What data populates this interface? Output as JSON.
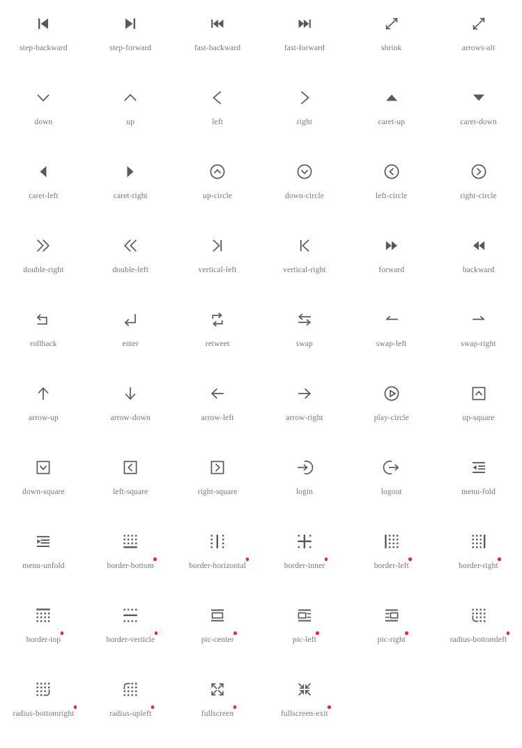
{
  "page": {
    "title": "Direction Icons",
    "icon_color": "#595959",
    "label_color": "#767676",
    "new_badge_color": "#f5222d",
    "background": "#ffffff",
    "columns": 6
  },
  "icons": [
    {
      "name": "step-backward",
      "glyph": "step-backward",
      "is_new": false
    },
    {
      "name": "step-forward",
      "glyph": "step-forward",
      "is_new": false
    },
    {
      "name": "fast-backward",
      "glyph": "fast-backward",
      "is_new": false
    },
    {
      "name": "fast-forward",
      "glyph": "fast-forward",
      "is_new": false
    },
    {
      "name": "shrink",
      "glyph": "shrink",
      "is_new": false
    },
    {
      "name": "arrows-alt",
      "glyph": "arrows-alt",
      "is_new": false
    },
    {
      "name": "down",
      "glyph": "down",
      "is_new": false
    },
    {
      "name": "up",
      "glyph": "up",
      "is_new": false
    },
    {
      "name": "left",
      "glyph": "left",
      "is_new": false
    },
    {
      "name": "right",
      "glyph": "right",
      "is_new": false
    },
    {
      "name": "caret-up",
      "glyph": "caret-up",
      "is_new": false
    },
    {
      "name": "caret-down",
      "glyph": "caret-down",
      "is_new": false
    },
    {
      "name": "caret-left",
      "glyph": "caret-left",
      "is_new": false
    },
    {
      "name": "caret-right",
      "glyph": "caret-right",
      "is_new": false
    },
    {
      "name": "up-circle",
      "glyph": "up-circle",
      "is_new": false
    },
    {
      "name": "down-circle",
      "glyph": "down-circle",
      "is_new": false
    },
    {
      "name": "left-circle",
      "glyph": "left-circle",
      "is_new": false
    },
    {
      "name": "right-circle",
      "glyph": "right-circle",
      "is_new": false
    },
    {
      "name": "double-right",
      "glyph": "double-right",
      "is_new": false
    },
    {
      "name": "double-left",
      "glyph": "double-left",
      "is_new": false
    },
    {
      "name": "vertical-left",
      "glyph": "vertical-left",
      "is_new": false
    },
    {
      "name": "vertical-right",
      "glyph": "vertical-right",
      "is_new": false
    },
    {
      "name": "forward",
      "glyph": "forward",
      "is_new": false
    },
    {
      "name": "backward",
      "glyph": "backward",
      "is_new": false
    },
    {
      "name": "rollback",
      "glyph": "rollback",
      "is_new": false
    },
    {
      "name": "enter",
      "glyph": "enter",
      "is_new": false
    },
    {
      "name": "retweet",
      "glyph": "retweet",
      "is_new": false
    },
    {
      "name": "swap",
      "glyph": "swap",
      "is_new": false
    },
    {
      "name": "swap-left",
      "glyph": "swap-left",
      "is_new": false
    },
    {
      "name": "swap-right",
      "glyph": "swap-right",
      "is_new": false
    },
    {
      "name": "arrow-up",
      "glyph": "arrow-up",
      "is_new": false
    },
    {
      "name": "arrow-down",
      "glyph": "arrow-down",
      "is_new": false
    },
    {
      "name": "arrow-left",
      "glyph": "arrow-left",
      "is_new": false
    },
    {
      "name": "arrow-right",
      "glyph": "arrow-right",
      "is_new": false
    },
    {
      "name": "play-circle",
      "glyph": "play-circle",
      "is_new": false
    },
    {
      "name": "up-square",
      "glyph": "up-square",
      "is_new": false
    },
    {
      "name": "down-square",
      "glyph": "down-square",
      "is_new": false
    },
    {
      "name": "left-square",
      "glyph": "left-square",
      "is_new": false
    },
    {
      "name": "right-square",
      "glyph": "right-square",
      "is_new": false
    },
    {
      "name": "login",
      "glyph": "login",
      "is_new": false
    },
    {
      "name": "logout",
      "glyph": "logout",
      "is_new": false
    },
    {
      "name": "menu-fold",
      "glyph": "menu-fold",
      "is_new": false
    },
    {
      "name": "menu-unfold",
      "glyph": "menu-unfold",
      "is_new": false
    },
    {
      "name": "border-bottom",
      "glyph": "border-bottom",
      "is_new": true
    },
    {
      "name": "border-horizontal",
      "glyph": "border-horizontal",
      "is_new": true
    },
    {
      "name": "border-inner",
      "glyph": "border-inner",
      "is_new": true
    },
    {
      "name": "border-left",
      "glyph": "border-left",
      "is_new": true
    },
    {
      "name": "border-right",
      "glyph": "border-right",
      "is_new": true
    },
    {
      "name": "border-top",
      "glyph": "border-top",
      "is_new": true
    },
    {
      "name": "border-verticle",
      "glyph": "border-verticle",
      "is_new": true
    },
    {
      "name": "pic-center",
      "glyph": "pic-center",
      "is_new": true
    },
    {
      "name": "pic-left",
      "glyph": "pic-left",
      "is_new": true
    },
    {
      "name": "pic-right",
      "glyph": "pic-right",
      "is_new": true
    },
    {
      "name": "radius-bottomleft",
      "glyph": "radius-bottomleft",
      "is_new": true
    },
    {
      "name": "radius-bottomright",
      "glyph": "radius-bottomright",
      "is_new": true
    },
    {
      "name": "radius-upleft",
      "glyph": "radius-upleft",
      "is_new": true
    },
    {
      "name": "fullscreen",
      "glyph": "fullscreen",
      "is_new": true
    },
    {
      "name": "fullscreen-exit",
      "glyph": "fullscreen-exit",
      "is_new": true
    }
  ]
}
